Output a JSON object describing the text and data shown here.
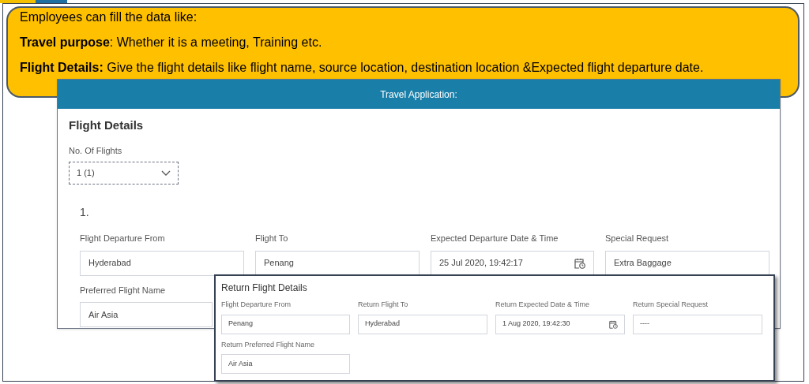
{
  "callout": {
    "lines": [
      "Employees can fill the data like:",
      "**Travel purpose**: Whether it is a meeting, Training etc.",
      "**Flight Details:** Give the flight details like flight  name, source location, destination location &Expected flight departure date."
    ]
  },
  "application": {
    "title": "Travel Application:",
    "section_title": "Flight Details",
    "flights_label": "No. Of Flights",
    "flights_value": "1 (1)",
    "flight_number": "1.",
    "fields": [
      {
        "label": "Flight Departure From",
        "value": "Hyderabad",
        "kind": "text"
      },
      {
        "label": "Flight To",
        "value": "Penang",
        "kind": "text"
      },
      {
        "label": "Expected Departure Date & Time",
        "value": "25 Jul 2020, 19:42:17",
        "kind": "datetime"
      },
      {
        "label": "Special Request",
        "value": "Extra Baggage",
        "kind": "text"
      },
      {
        "label": "Preferred Flight Name",
        "value": "Air Asia",
        "kind": "text"
      }
    ]
  },
  "return_flight": {
    "title": "Return Flight Details",
    "fields": [
      {
        "label": "Flight Departure From",
        "value": "Penang",
        "kind": "text"
      },
      {
        "label": "Return Flight To",
        "value": "Hyderabad",
        "kind": "text"
      },
      {
        "label": "Return Expected Date & Time",
        "value": "1 Aug 2020, 19:42:30",
        "kind": "datetime"
      },
      {
        "label": "Return Special Request",
        "value": "----",
        "kind": "text"
      },
      {
        "label": "Return Preferred Flight Name",
        "value": "Air Asia",
        "kind": "text"
      }
    ]
  }
}
